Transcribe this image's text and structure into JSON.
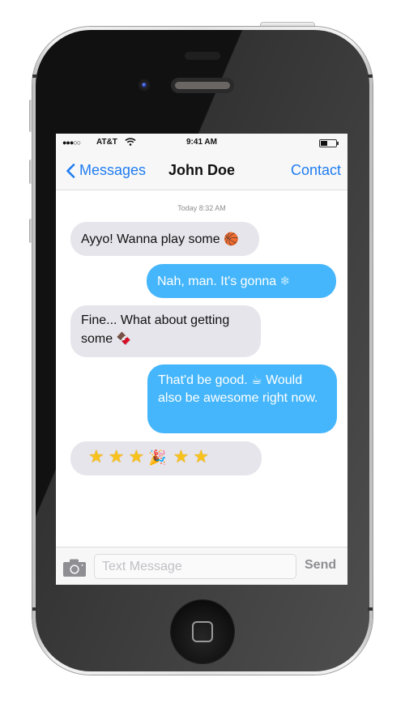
{
  "status_bar": {
    "signal": "●●●○○",
    "carrier": "AT&T",
    "time": "9:41 AM",
    "battery_level": 0.45
  },
  "nav": {
    "back_label": "Messages",
    "title": "John Doe",
    "contact_label": "Contact"
  },
  "thread": {
    "timestamp": "Today 8:32 AM",
    "messages": [
      {
        "direction": "incoming",
        "text": "Ayyo! Wanna play some",
        "emoji": "🏀",
        "emoji_name": "basketball"
      },
      {
        "direction": "outgoing",
        "text": "Nah, man. It's gonna",
        "emoji": "❄",
        "emoji_name": "snowflake"
      },
      {
        "direction": "incoming",
        "text": "Fine... What about getting some",
        "emoji": "🍫",
        "emoji_name": "chocolate-bar"
      },
      {
        "direction": "outgoing",
        "text_before": "That'd be good.",
        "emoji": "☕",
        "emoji_name": "hot-beverage",
        "text_after": "Would also be awesome right now."
      },
      {
        "direction": "incoming",
        "emojis": [
          "★",
          "★",
          "★",
          "🎉",
          "★",
          "★"
        ],
        "emoji_names": [
          "star",
          "star",
          "star",
          "party-popper",
          "star",
          "star"
        ]
      }
    ]
  },
  "input_bar": {
    "placeholder": "Text Message",
    "value": "",
    "send_label": "Send"
  }
}
